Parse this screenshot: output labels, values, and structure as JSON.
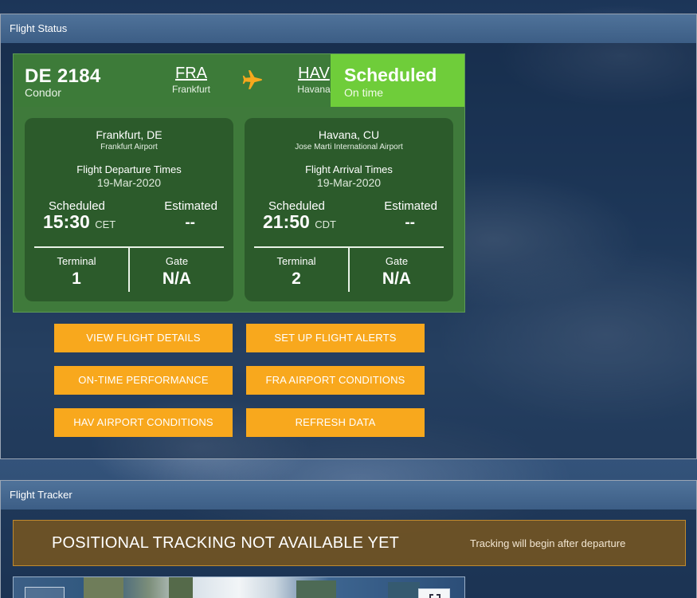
{
  "status_panel": {
    "title": "Flight Status",
    "flight_number": "DE 2184",
    "airline": "Condor",
    "origin": {
      "code": "FRA",
      "city": "Frankfurt"
    },
    "destination": {
      "code": "HAV",
      "city": "Havana"
    },
    "status": "Scheduled",
    "status_sub": "On time",
    "colors": {
      "card": "#3f7a3b",
      "status": "#6fcd3a",
      "leg": "#2c5b2b",
      "button": "#f8a81d"
    },
    "departure": {
      "city": "Frankfurt, DE",
      "airport": "Frankfurt Airport",
      "title": "Flight Departure Times",
      "date": "19-Mar-2020",
      "scheduled_label": "Scheduled",
      "estimated_label": "Estimated",
      "scheduled_time": "15:30",
      "tz": "CET",
      "estimated_time": "--",
      "terminal_label": "Terminal",
      "gate_label": "Gate",
      "terminal": "1",
      "gate": "N/A"
    },
    "arrival": {
      "city": "Havana, CU",
      "airport": "Jose Marti International Airport",
      "title": "Flight Arrival Times",
      "date": "19-Mar-2020",
      "scheduled_label": "Scheduled",
      "estimated_label": "Estimated",
      "scheduled_time": "21:50",
      "tz": "CDT",
      "estimated_time": "--",
      "terminal_label": "Terminal",
      "gate_label": "Gate",
      "terminal": "2",
      "gate": "N/A"
    },
    "buttons": {
      "view_details": "VIEW FLIGHT DETAILS",
      "alerts": "SET UP FLIGHT ALERTS",
      "ontime": "ON-TIME PERFORMANCE",
      "fra_conditions": "FRA AIRPORT CONDITIONS",
      "hav_conditions": "HAV AIRPORT CONDITIONS",
      "refresh": "REFRESH DATA"
    }
  },
  "tracker_panel": {
    "title": "Flight Tracker",
    "banner_title": "POSITIONAL TRACKING NOT AVAILABLE YET",
    "banner_sub": "Tracking will begin after departure",
    "icons": {
      "plane": "plane-icon",
      "fullscreen": "fullscreen-icon"
    }
  }
}
